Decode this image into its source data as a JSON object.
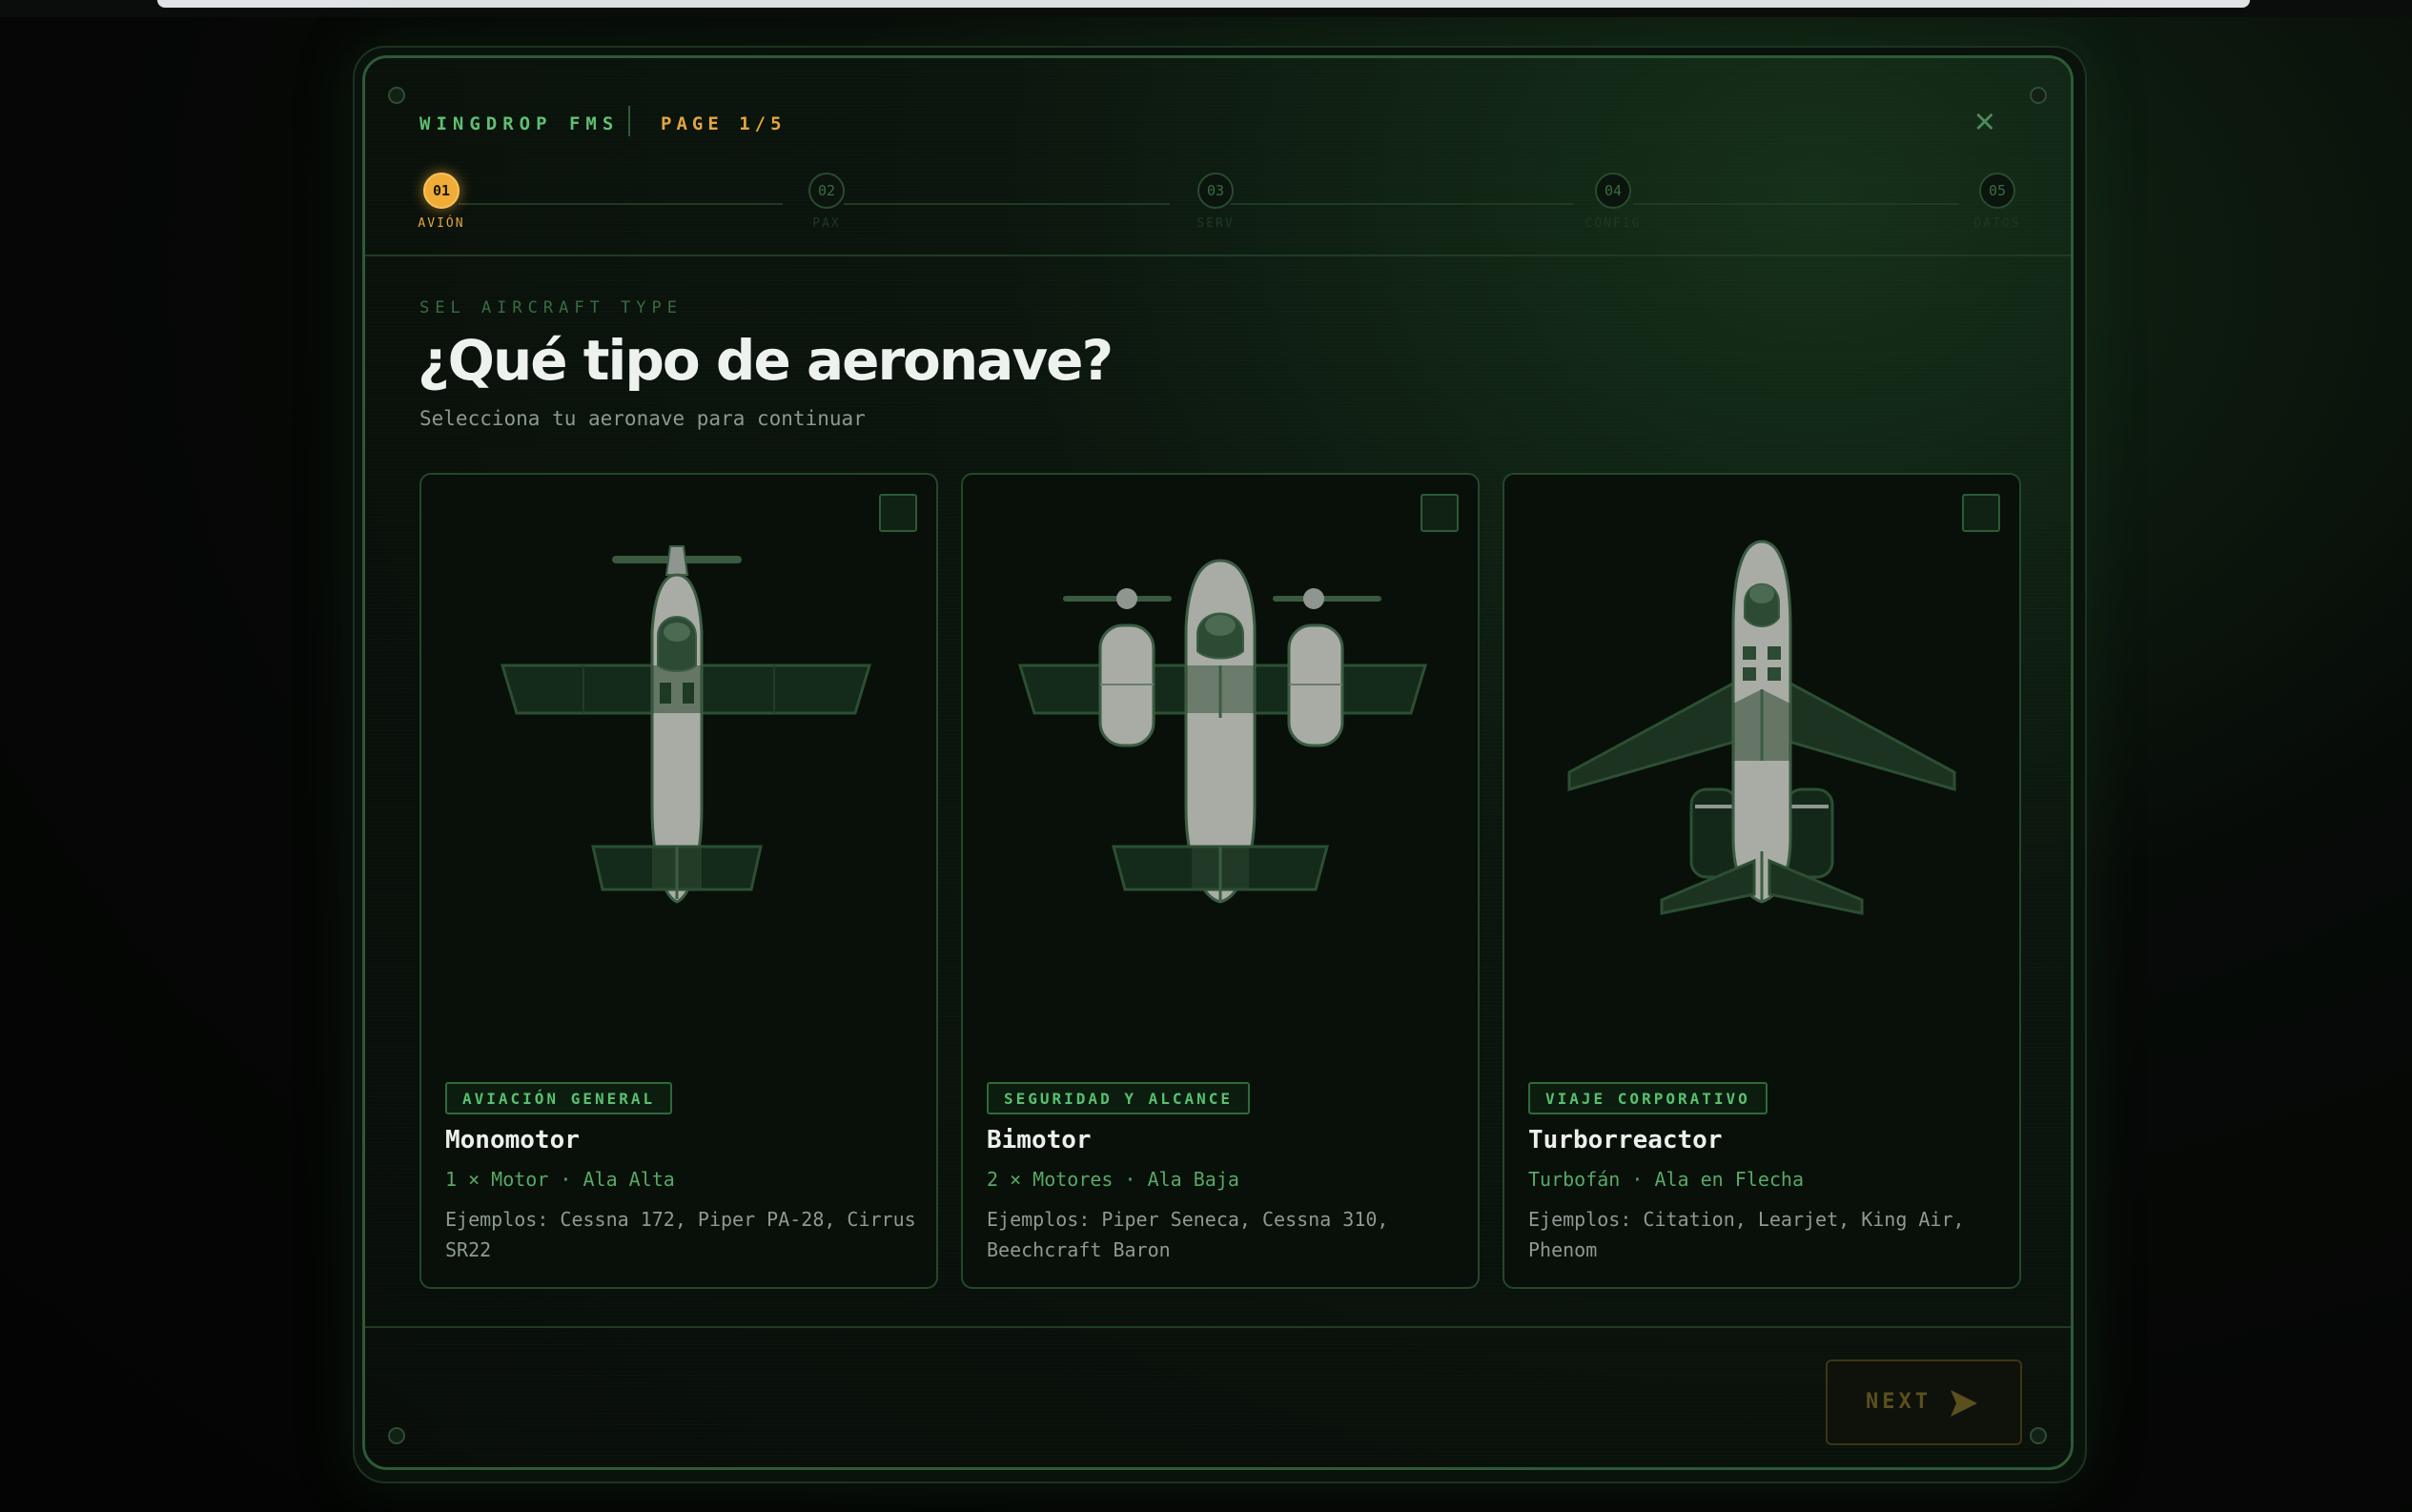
{
  "app": {
    "brand": "WINGDROP FMS",
    "page_indicator": "PAGE 1/5"
  },
  "steps": [
    {
      "num": "01",
      "label": "AVIÓN",
      "active": true
    },
    {
      "num": "02",
      "label": "PAX",
      "active": false
    },
    {
      "num": "03",
      "label": "SERV",
      "active": false
    },
    {
      "num": "04",
      "label": "CONFIG",
      "active": false
    },
    {
      "num": "05",
      "label": "DATOS",
      "active": false
    }
  ],
  "header": {
    "eyebrow": "SEL AIRCRAFT TYPE",
    "title": "¿Qué tipo de aeronave?",
    "subtitle": "Selecciona tu aeronave para continuar"
  },
  "cards": [
    {
      "tag": "AVIACIÓN GENERAL",
      "name": "Monomotor",
      "spec": "1 × Motor · Ala Alta",
      "examples": "Ejemplos: Cessna 172, Piper PA-28, Cirrus SR22",
      "icon": "single-engine-plane-icon",
      "selected": false
    },
    {
      "tag": "SEGURIDAD Y ALCANCE",
      "name": "Bimotor",
      "spec": "2 × Motores · Ala Baja",
      "examples": "Ejemplos: Piper Seneca, Cessna 310, Beechcraft Baron",
      "icon": "twin-engine-plane-icon",
      "selected": false
    },
    {
      "tag": "VIAJE CORPORATIVO",
      "name": "Turborreactor",
      "spec": "Turbofán · Ala en Flecha",
      "examples": "Ejemplos: Citation, Learjet, King Air, Phenom",
      "icon": "jet-plane-icon",
      "selected": false
    }
  ],
  "footer": {
    "next_label": "NEXT"
  },
  "colors": {
    "accent": "#f0ac36",
    "green": "#59c06e",
    "background": "#080d09",
    "border": "#2d5a35"
  }
}
